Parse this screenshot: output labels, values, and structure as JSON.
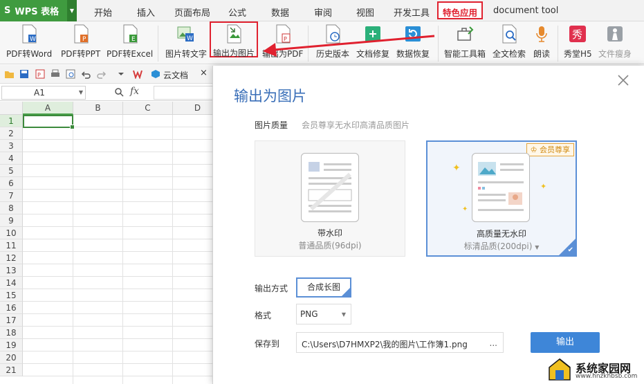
{
  "app": {
    "logo": "S",
    "name": "WPS 表格"
  },
  "menu": {
    "tabs": [
      "开始",
      "插入",
      "页面布局",
      "公式",
      "数据",
      "审阅",
      "视图",
      "开发工具",
      "特色应用",
      "document tool"
    ],
    "active": "特色应用"
  },
  "ribbon": {
    "pdf_word": "PDF转Word",
    "pdf_ppt": "PDF转PPT",
    "pdf_excel": "PDF转Excel",
    "img_text": "图片转文字",
    "export_image": "输出为图片",
    "export_pdf": "输出为PDF",
    "history": "历史版本",
    "doc_repair": "文档修复",
    "data_recovery": "数据恢复",
    "smart_toolbox": "智能工具箱",
    "full_search": "全文检索",
    "read_aloud": "朗读",
    "xiutang": "秀堂H5",
    "slim": "文件瘦身",
    "xiu_glyph": "秀"
  },
  "quickbar": {
    "cloud_docs": "云文档"
  },
  "formula_bar": {
    "cell_ref": "A1",
    "fx": "fx"
  },
  "grid": {
    "columns": [
      "A",
      "B",
      "C",
      "D"
    ],
    "rows": [
      "1",
      "2",
      "3",
      "4",
      "5",
      "6",
      "7",
      "8",
      "9",
      "10",
      "11",
      "12",
      "13",
      "14",
      "15",
      "16",
      "17",
      "18",
      "19",
      "20",
      "21"
    ]
  },
  "dialog": {
    "title": "输出为图片",
    "quality_label": "图片质量",
    "quality_hint": "会员尊享无水印高清品质图片",
    "option_watermark": {
      "name": "带水印",
      "sub": "普通品质(96dpi)"
    },
    "option_hq": {
      "name": "高质量无水印",
      "sub": "标清品质(200dpi)",
      "badge": "会员尊享"
    },
    "mode_label": "输出方式",
    "mode_value": "合成长图",
    "format_label": "格式",
    "format_value": "PNG",
    "save_label": "保存到",
    "save_path": "C:\\Users\\D7HMXP2\\我的图片\\工作簿1.png",
    "browse": "...",
    "export_button": "输出"
  },
  "watermark": {
    "title": "系统家园网",
    "url": "www.hnzkhbsb.com"
  },
  "colors": {
    "accent": "#3e86d8",
    "wps_green": "#3f9b3f",
    "highlight_red": "#e0212f"
  }
}
